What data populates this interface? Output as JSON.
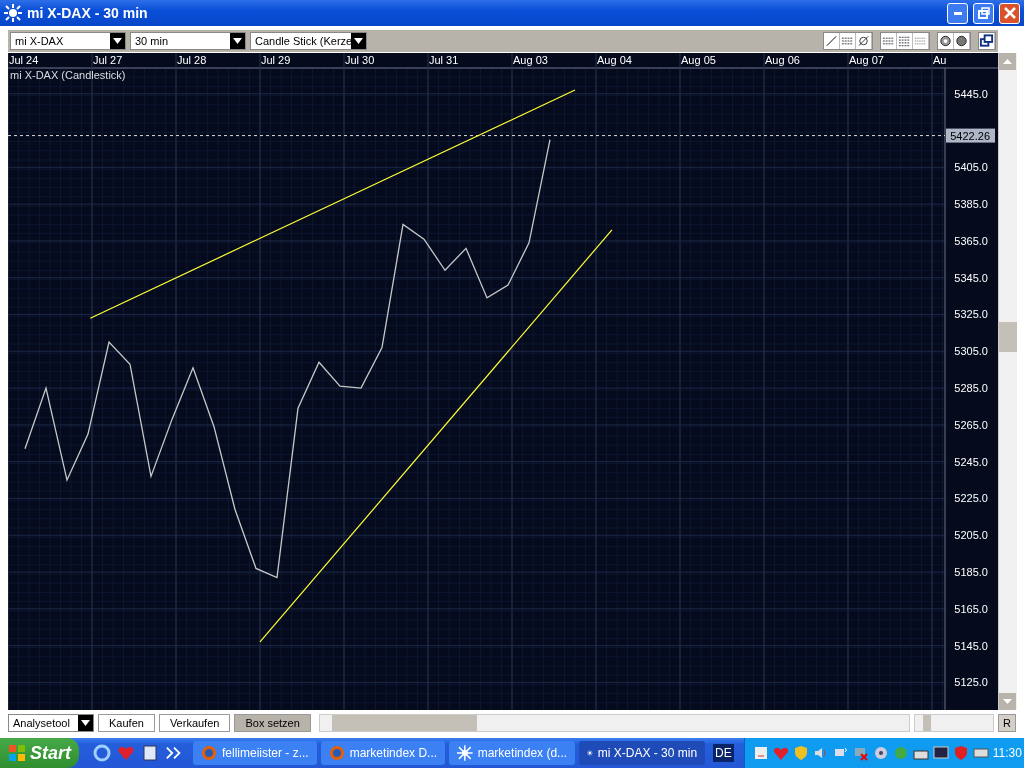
{
  "window": {
    "title": "mi X-DAX - 30 min"
  },
  "toolbar": {
    "symbol_select": "mi X-DAX",
    "interval_select": "30 min",
    "chart_type_select": "Candle Stick (Kerze"
  },
  "chart": {
    "chart_data": {
      "type": "line",
      "title": "mi X-DAX (Candlestick)",
      "categories": [
        "Jul 24",
        null,
        null,
        null,
        "Jul 27",
        null,
        null,
        null,
        "Jul 28",
        null,
        null,
        null,
        "Jul 29",
        null,
        null,
        null,
        "Jul 30",
        null,
        null,
        null,
        "Jul 31",
        null,
        null,
        null,
        "Aug 03",
        null,
        null,
        null,
        "Aug 04",
        null,
        null,
        null,
        "Aug 05",
        null,
        null,
        null,
        "Aug 06",
        null,
        null,
        null,
        "Aug 07",
        null,
        null,
        null,
        "Au"
      ],
      "series": [
        {
          "color": "#c8c8c8",
          "values": [
            5252,
            5285,
            5235,
            5260,
            5310,
            5298,
            5237,
            5268,
            5296,
            5264,
            5219,
            5187,
            5182,
            5274,
            5299,
            5286,
            5285,
            5307,
            5374,
            5366,
            5349,
            5361,
            5334,
            5341,
            5364,
            5420,
            null,
            null,
            null,
            null,
            null,
            null,
            null,
            null,
            null,
            null,
            null,
            null,
            null,
            null,
            null,
            null,
            null,
            null,
            null
          ]
        }
      ],
      "ylim": [
        5110,
        5459
      ],
      "grid": true,
      "ref_lines": [
        {
          "axis": "y",
          "value": 5422.26,
          "label": "5422.26"
        }
      ],
      "yticks": [
        {
          "value": 5125,
          "label": "5125.0"
        },
        {
          "value": 5145,
          "label": "5145.0"
        },
        {
          "value": 5165,
          "label": "5165.0"
        },
        {
          "value": 5185,
          "label": "5185.0"
        },
        {
          "value": 5205,
          "label": "5205.0"
        },
        {
          "value": 5225,
          "label": "5225.0"
        },
        {
          "value": 5245,
          "label": "5245.0"
        },
        {
          "value": 5265,
          "label": "5265.0"
        },
        {
          "value": 5285,
          "label": "5285.0"
        },
        {
          "value": 5305,
          "label": "5305.0"
        },
        {
          "value": 5325,
          "label": "5325.0"
        },
        {
          "value": 5345,
          "label": "5345.0"
        },
        {
          "value": 5365,
          "label": "5365.0"
        },
        {
          "value": 5385,
          "label": "5385.0"
        },
        {
          "value": 5405,
          "label": "5405.0"
        },
        {
          "value": 5445,
          "label": "5445.0"
        }
      ]
    }
  },
  "bottom_bar": {
    "tool_select": "Analysetool",
    "buttons": [
      {
        "label": "Kaufen",
        "selected": false
      },
      {
        "label": "Verkaufen",
        "selected": false
      },
      {
        "label": "Box setzen",
        "selected": true
      }
    ],
    "zoom": {
      "level": 0.12
    },
    "reset_button": "R"
  },
  "taskbar": {
    "start": "Start",
    "tasks": [
      {
        "label": "fellimeiister - z...",
        "kind": "browser",
        "selected": false
      },
      {
        "label": "marketindex D...",
        "kind": "browser",
        "selected": false
      },
      {
        "label": "marketindex (d...",
        "kind": "app",
        "selected": false
      },
      {
        "label": "mi X-DAX - 30 min",
        "kind": "app",
        "selected": true
      }
    ],
    "language": "DE",
    "clock": "11:30"
  }
}
